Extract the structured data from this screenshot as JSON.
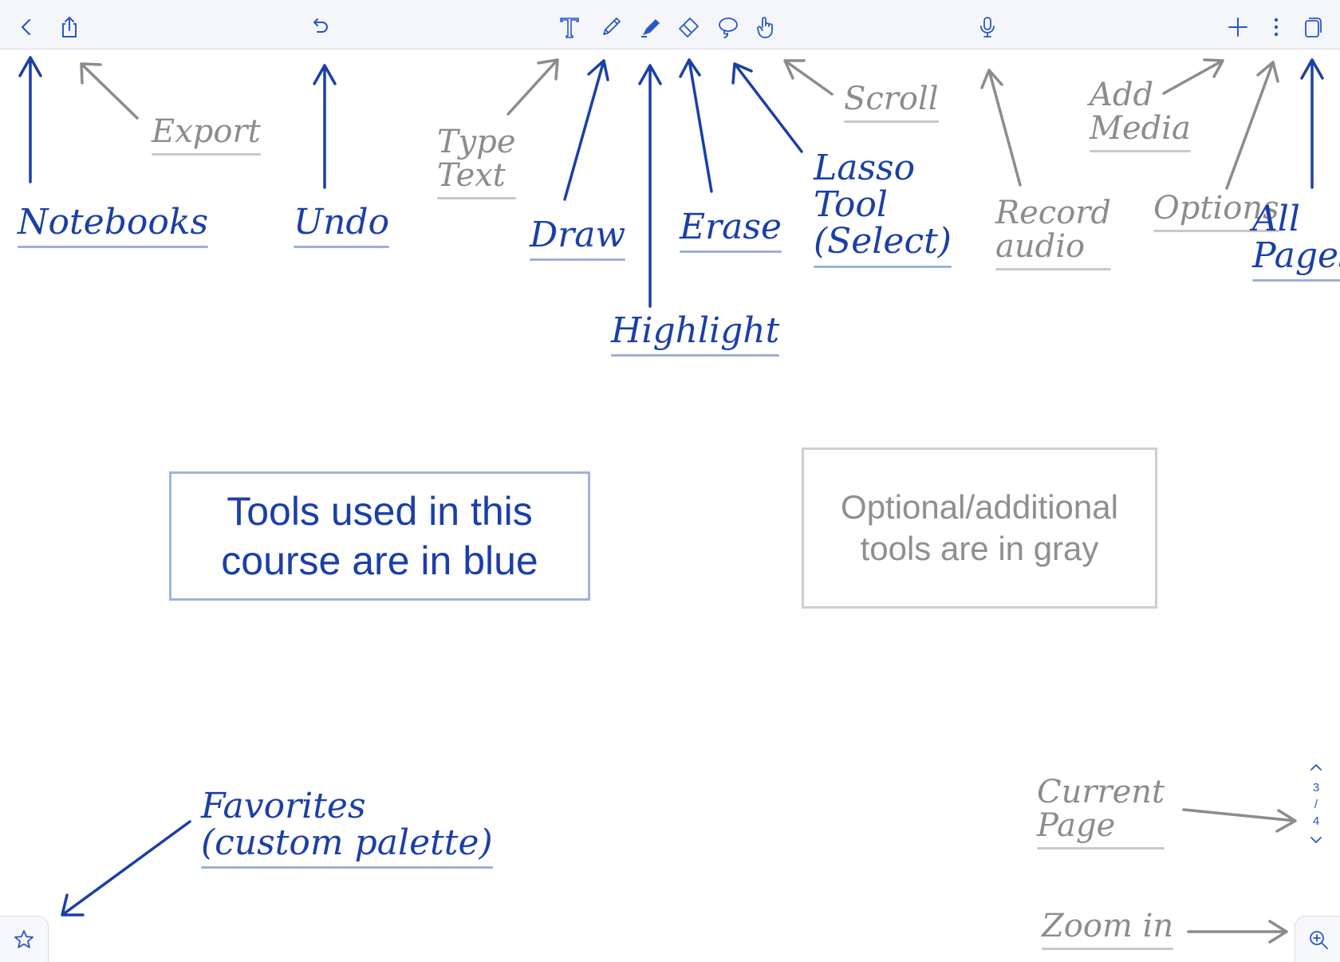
{
  "toolbar": {
    "buttons": [
      {
        "name": "back-button",
        "icon": "chevron-left-icon"
      },
      {
        "name": "export-button",
        "icon": "share-icon"
      },
      {
        "name": "undo-button",
        "icon": "undo-icon"
      },
      {
        "name": "type-text-button",
        "icon": "text-tool-icon"
      },
      {
        "name": "draw-button",
        "icon": "pen-icon"
      },
      {
        "name": "highlight-button",
        "icon": "highlighter-icon"
      },
      {
        "name": "erase-button",
        "icon": "eraser-icon"
      },
      {
        "name": "lasso-button",
        "icon": "lasso-icon"
      },
      {
        "name": "scroll-button",
        "icon": "hand-pointer-icon"
      },
      {
        "name": "record-audio-button",
        "icon": "microphone-icon"
      },
      {
        "name": "add-media-button",
        "icon": "plus-icon"
      },
      {
        "name": "options-button",
        "icon": "more-vertical-icon"
      },
      {
        "name": "all-pages-button",
        "icon": "pages-icon"
      }
    ],
    "accent_color": "#2a56c6"
  },
  "annotations": {
    "notebooks": "Notebooks",
    "export": "Export",
    "undo": "Undo",
    "type_text": "Type\nText",
    "draw": "Draw",
    "highlight": "Highlight",
    "erase": "Erase",
    "lasso": "Lasso\nTool\n(Select)",
    "scroll": "Scroll",
    "record_audio": "Record\naudio",
    "add_media": "Add\nMedia",
    "options": "Options",
    "all_pages": "All\nPages",
    "favorites": "Favorites\n(custom palette)",
    "current_page": "Current\nPage",
    "zoom_in": "Zoom in"
  },
  "legend": {
    "blue_box": "Tools used in this course are in blue",
    "gray_box": "Optional/additional tools are in gray",
    "blue_color": "#1b3fa8",
    "gray_color": "#8c8c8c"
  },
  "pager": {
    "current": "3",
    "separator": "/",
    "total": "4"
  },
  "bottom": {
    "favorites_icon": "star-icon",
    "zoom_icon": "zoom-in-icon"
  }
}
